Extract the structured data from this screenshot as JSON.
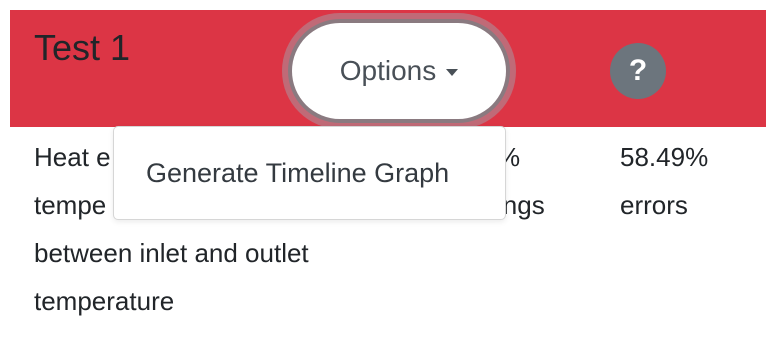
{
  "header": {
    "title": "Test 1",
    "options_label": "Options",
    "help_label": "?",
    "background_color": "#dc3545"
  },
  "row": {
    "description_lines": [
      "Heat e",
      "tempe",
      "between inlet and outlet",
      "temperature"
    ],
    "col_a_lines": [
      "%",
      "ings"
    ],
    "col_b_lines": [
      "58.49%",
      "errors"
    ]
  },
  "dropdown": {
    "items": [
      {
        "label": "Generate Timeline Graph"
      }
    ]
  },
  "icons": {
    "caret": "chevron-down-icon",
    "help": "question-icon"
  }
}
